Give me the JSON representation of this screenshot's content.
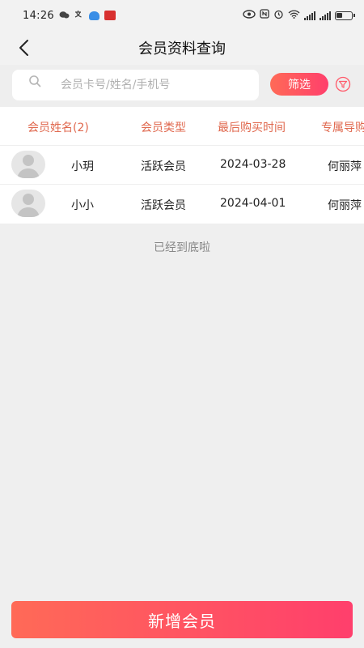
{
  "status_bar": {
    "time": "14:26"
  },
  "header": {
    "title": "会员资料查询"
  },
  "search": {
    "placeholder": "会员卡号/姓名/手机号",
    "value": "",
    "filter_label": "筛选"
  },
  "table": {
    "columns": [
      "会员姓名(2)",
      "会员类型",
      "最后购买时间",
      "专属导购"
    ],
    "rows": [
      {
        "name": "小玥",
        "type": "活跃会员",
        "last_purchase": "2024-03-28",
        "guide": "何丽萍"
      },
      {
        "name": "小小",
        "type": "活跃会员",
        "last_purchase": "2024-04-01",
        "guide": "何丽萍"
      }
    ]
  },
  "list_end_text": "已经到底啦",
  "footer": {
    "add_label": "新增会员"
  },
  "colors": {
    "accent": "#ff4f63",
    "header_text": "#e0694f"
  }
}
